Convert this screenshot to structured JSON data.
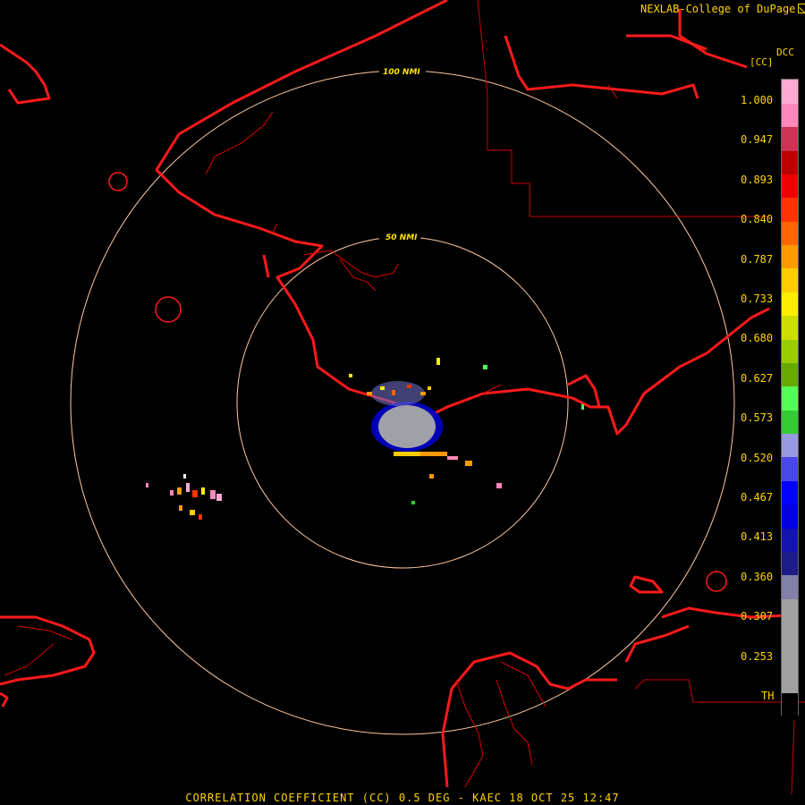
{
  "credit": "NEXLAB-College of DuPage",
  "legend": {
    "code": "DCC",
    "unit": "[CC]",
    "ticks": [
      "1.000",
      "0.947",
      "0.893",
      "0.840",
      "0.787",
      "0.733",
      "0.680",
      "0.627",
      "0.573",
      "0.520",
      "0.467",
      "0.413",
      "0.360",
      "0.307",
      "0.253",
      "TH"
    ],
    "colors": [
      "#000000",
      "#a0a0a0",
      "#a0a0a0",
      "#a0a0a0",
      "#a0a0a0",
      "#8080a8",
      "#1c1c88",
      "#1414b0",
      "#0000e0",
      "#0000ff",
      "#4848e8",
      "#9898e0",
      "#33cc33",
      "#55ff55",
      "#66aa00",
      "#99cc00",
      "#ccdd00",
      "#ffee00",
      "#ffcc00",
      "#ff9900",
      "#ff6600",
      "#ff3300",
      "#ee0000",
      "#bb0000",
      "#cc3355",
      "#ff88bb",
      "#ffaad0"
    ]
  },
  "rings": [
    {
      "label": "50 NMI"
    },
    {
      "label": "100 NMI"
    }
  ],
  "footer": "CORRELATION COEFFICIENT (CC) 0.5 DEG - KAEC 18 OCT 25 12:47",
  "colors": {
    "text": "#ffd400",
    "coast": "#ff1a1a",
    "ring": "#ffc8a0",
    "ring_label": "#ffe000"
  }
}
